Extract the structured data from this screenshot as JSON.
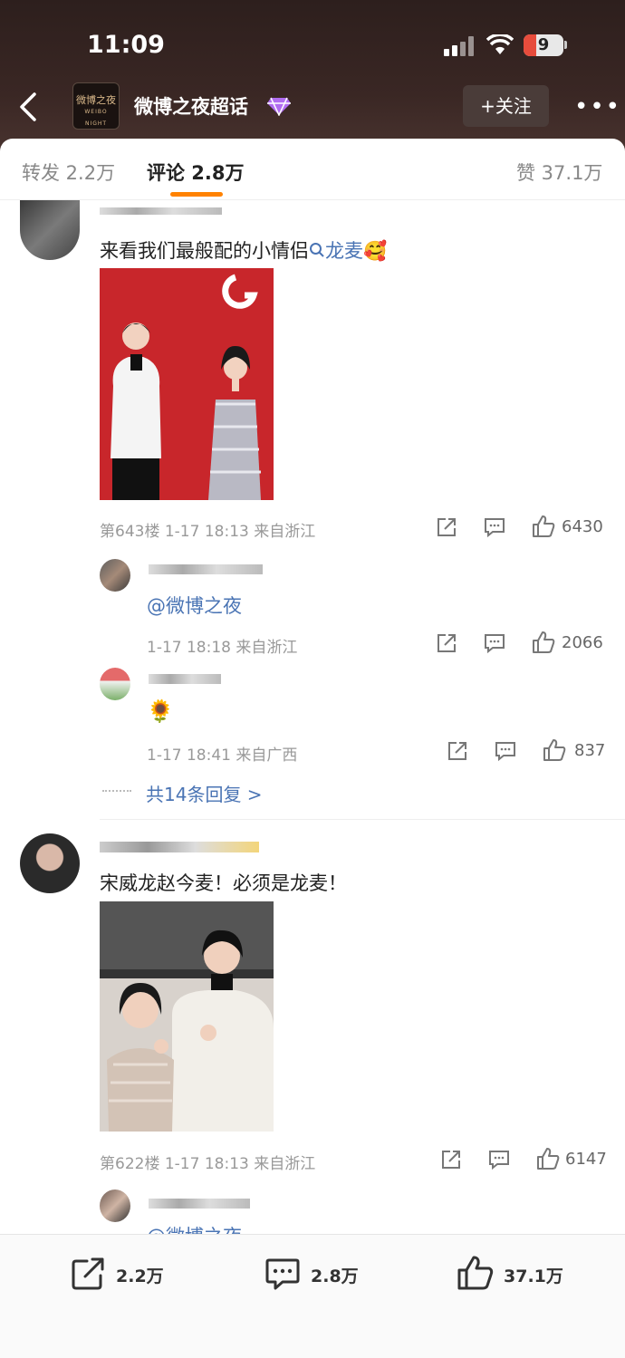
{
  "status_bar": {
    "time": "11:09",
    "battery": "9"
  },
  "nav": {
    "title": "微博之夜超话",
    "follow_label": "+关注",
    "more": "•••",
    "logo_text": "微博之夜",
    "logo_sub": "WEIBO NIGHT"
  },
  "tabs": {
    "repost": "转发 2.2万",
    "comment": "评论 2.8万",
    "like": "赞 37.1万"
  },
  "comments": [
    {
      "text": "来看我们最般配的小情侣",
      "topic": "龙麦",
      "emoji": "🥰",
      "meta": "第643楼  1-17 18:13  来自浙江",
      "likes": "6430",
      "replies": [
        {
          "text": "@微博之夜",
          "meta": "1-17 18:18  来自浙江",
          "likes": "2066"
        },
        {
          "text": "🌻",
          "meta": "1-17 18:41  来自广西",
          "likes": "837"
        }
      ],
      "more_replies": "共14条回复 >"
    },
    {
      "text": "宋威龙赵今麦！必须是龙麦！",
      "meta": "第622楼  1-17 18:13  来自浙江",
      "likes": "6147",
      "replies": [
        {
          "text": "@微博之夜"
        }
      ]
    }
  ],
  "bottom_bar": {
    "repost": "2.2万",
    "comment": "2.8万",
    "like": "37.1万"
  },
  "colors": {
    "accent": "#ff8200",
    "link": "#4a74b4",
    "header_bg": "#3a2724"
  }
}
